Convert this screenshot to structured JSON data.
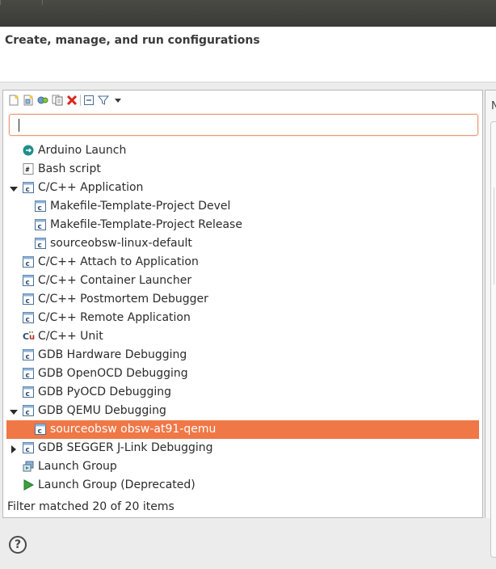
{
  "dialog": {
    "header_title": "Create, manage, and run configurations"
  },
  "toolbar": {
    "buttons": [
      "new-configuration-icon",
      "new-prototype-icon",
      "export-icon",
      "duplicate-icon",
      "delete-icon",
      "collapse-all-icon",
      "filter-icon",
      "view-menu-icon"
    ]
  },
  "filter": {
    "value": "",
    "placeholder": ""
  },
  "tree": {
    "items": [
      {
        "label": "Arduino Launch",
        "icon": "arduino-icon"
      },
      {
        "label": "Bash script",
        "icon": "bash-icon"
      },
      {
        "label": "C/C++ Application",
        "icon": "c-app-icon",
        "expanded": true
      },
      {
        "label": "Makefile-Template-Project Devel",
        "icon": "c-app-icon"
      },
      {
        "label": "Makefile-Template-Project Release",
        "icon": "c-app-icon"
      },
      {
        "label": "sourceobsw-linux-default",
        "icon": "c-app-icon"
      },
      {
        "label": "C/C++ Attach to Application",
        "icon": "c-app-icon"
      },
      {
        "label": "C/C++ Container Launcher",
        "icon": "c-app-icon"
      },
      {
        "label": "C/C++ Postmortem Debugger",
        "icon": "c-app-icon"
      },
      {
        "label": "C/C++ Remote Application",
        "icon": "c-app-icon"
      },
      {
        "label": "C/C++ Unit",
        "icon": "c-unit-icon"
      },
      {
        "label": "GDB Hardware Debugging",
        "icon": "c-app-icon"
      },
      {
        "label": "GDB OpenOCD Debugging",
        "icon": "c-app-icon"
      },
      {
        "label": "GDB PyOCD Debugging",
        "icon": "c-app-icon"
      },
      {
        "label": "GDB QEMU Debugging",
        "icon": "c-app-icon",
        "expanded": true
      },
      {
        "label": "sourceobsw obsw-at91-qemu",
        "icon": "c-app-icon",
        "selected": true
      },
      {
        "label": "GDB SEGGER J-Link Debugging",
        "icon": "c-app-icon",
        "expanded": false
      },
      {
        "label": "Launch Group",
        "icon": "launch-group-icon"
      },
      {
        "label": "Launch Group (Deprecated)",
        "icon": "run-icon"
      }
    ]
  },
  "status": {
    "text": "Filter matched 20 of 20 items"
  },
  "right_panel": {
    "tab_letter": "N"
  },
  "help": {
    "label": "?"
  },
  "colors": {
    "selection": "#f07746",
    "titlebar": "#3c3c38",
    "filter_border": "#e89a7a"
  }
}
